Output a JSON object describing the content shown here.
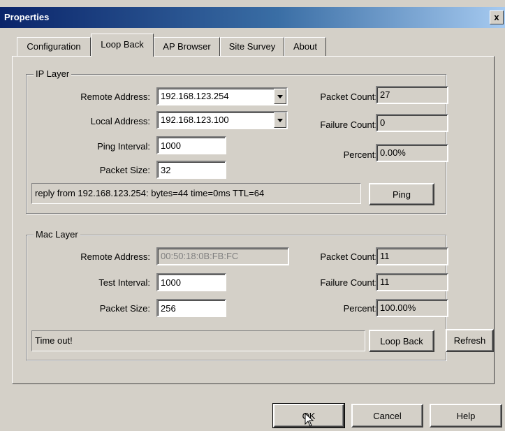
{
  "window": {
    "title": "Properties",
    "close_glyph": "x"
  },
  "tabs": [
    {
      "label": "Configuration"
    },
    {
      "label": "Loop Back",
      "active": true
    },
    {
      "label": "AP Browser"
    },
    {
      "label": "Site Survey"
    },
    {
      "label": "About"
    }
  ],
  "ip_layer": {
    "title": "IP Layer",
    "remote_address_label": "Remote Address:",
    "remote_address_value": "192.168.123.254",
    "local_address_label": "Local Address:",
    "local_address_value": "192.168.123.100",
    "ping_interval_label": "Ping Interval:",
    "ping_interval_value": "1000",
    "packet_size_label": "Packet Size:",
    "packet_size_value": "32",
    "packet_count_label": "Packet Count:",
    "packet_count_value": "27",
    "failure_count_label": "Failure Count:",
    "failure_count_value": "0",
    "percent_label": "Percent:",
    "percent_value": "0.00%",
    "status_text": "reply from 192.168.123.254: bytes=44 time=0ms TTL=64",
    "ping_button": "Ping"
  },
  "mac_layer": {
    "title": "Mac Layer",
    "remote_address_label": "Remote Address:",
    "remote_address_value": "00:50:18:0B:FB:FC",
    "test_interval_label": "Test Interval:",
    "test_interval_value": "1000",
    "packet_size_label": "Packet Size:",
    "packet_size_value": "256",
    "packet_count_label": "Packet Count:",
    "packet_count_value": "11",
    "failure_count_label": "Failure Count:",
    "failure_count_value": "11",
    "percent_label": "Percent:",
    "percent_value": "100.00%",
    "status_text": "Time out!",
    "loopback_button": "Loop Back"
  },
  "refresh_button": "Refresh",
  "dialog_buttons": {
    "ok": "OK",
    "cancel": "Cancel",
    "help": "Help"
  },
  "icons": {
    "dropdown": "chevron-down-icon",
    "cursor": "mouse-pointer-icon"
  }
}
